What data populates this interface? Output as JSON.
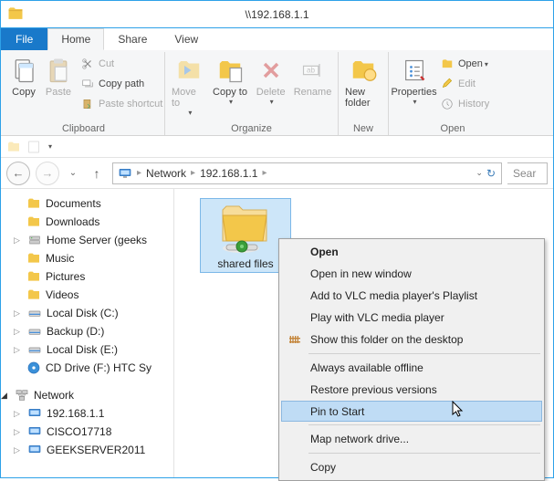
{
  "window": {
    "title": "\\\\192.168.1.1"
  },
  "tabs": {
    "file": "File",
    "home": "Home",
    "share": "Share",
    "view": "View"
  },
  "ribbon": {
    "clipboard": {
      "label": "Clipboard",
      "copy": "Copy",
      "paste": "Paste",
      "cut": "Cut",
      "copy_path": "Copy path",
      "paste_shortcut": "Paste shortcut"
    },
    "organize": {
      "label": "Organize",
      "move_to": "Move to",
      "copy_to": "Copy to",
      "delete": "Delete",
      "rename": "Rename"
    },
    "new": {
      "label": "New",
      "new_folder": "New folder"
    },
    "open": {
      "label": "Open",
      "properties": "Properties",
      "open": "Open",
      "edit": "Edit",
      "history": "History"
    }
  },
  "address": {
    "root": "Network",
    "host": "192.168.1.1",
    "search_placeholder": "Sear"
  },
  "nav": {
    "items": [
      {
        "id": "documents",
        "label": "Documents"
      },
      {
        "id": "downloads",
        "label": "Downloads"
      },
      {
        "id": "homeserver",
        "label": "Home Server (geeks"
      },
      {
        "id": "music",
        "label": "Music"
      },
      {
        "id": "pictures",
        "label": "Pictures"
      },
      {
        "id": "videos",
        "label": "Videos"
      },
      {
        "id": "localc",
        "label": "Local Disk (C:)"
      },
      {
        "id": "backupd",
        "label": "Backup (D:)"
      },
      {
        "id": "locale",
        "label": "Local Disk (E:)"
      },
      {
        "id": "cddrive",
        "label": "CD Drive (F:) HTC Sy"
      }
    ],
    "network_root": "Network",
    "network_children": [
      {
        "id": "net-host",
        "label": "192.168.1.1"
      },
      {
        "id": "net-cisco",
        "label": "CISCO17718"
      },
      {
        "id": "net-geek",
        "label": "GEEKSERVER2011"
      }
    ]
  },
  "content": {
    "folder_label": "shared files"
  },
  "context_menu": {
    "open": "Open",
    "open_new": "Open in new window",
    "vlc_playlist": "Add to VLC media player's Playlist",
    "vlc_play": "Play with VLC media player",
    "show_desktop": "Show this folder on the desktop",
    "offline": "Always available offline",
    "restore": "Restore previous versions",
    "pin_start": "Pin to Start",
    "map_drive": "Map network drive...",
    "copy": "Copy"
  }
}
